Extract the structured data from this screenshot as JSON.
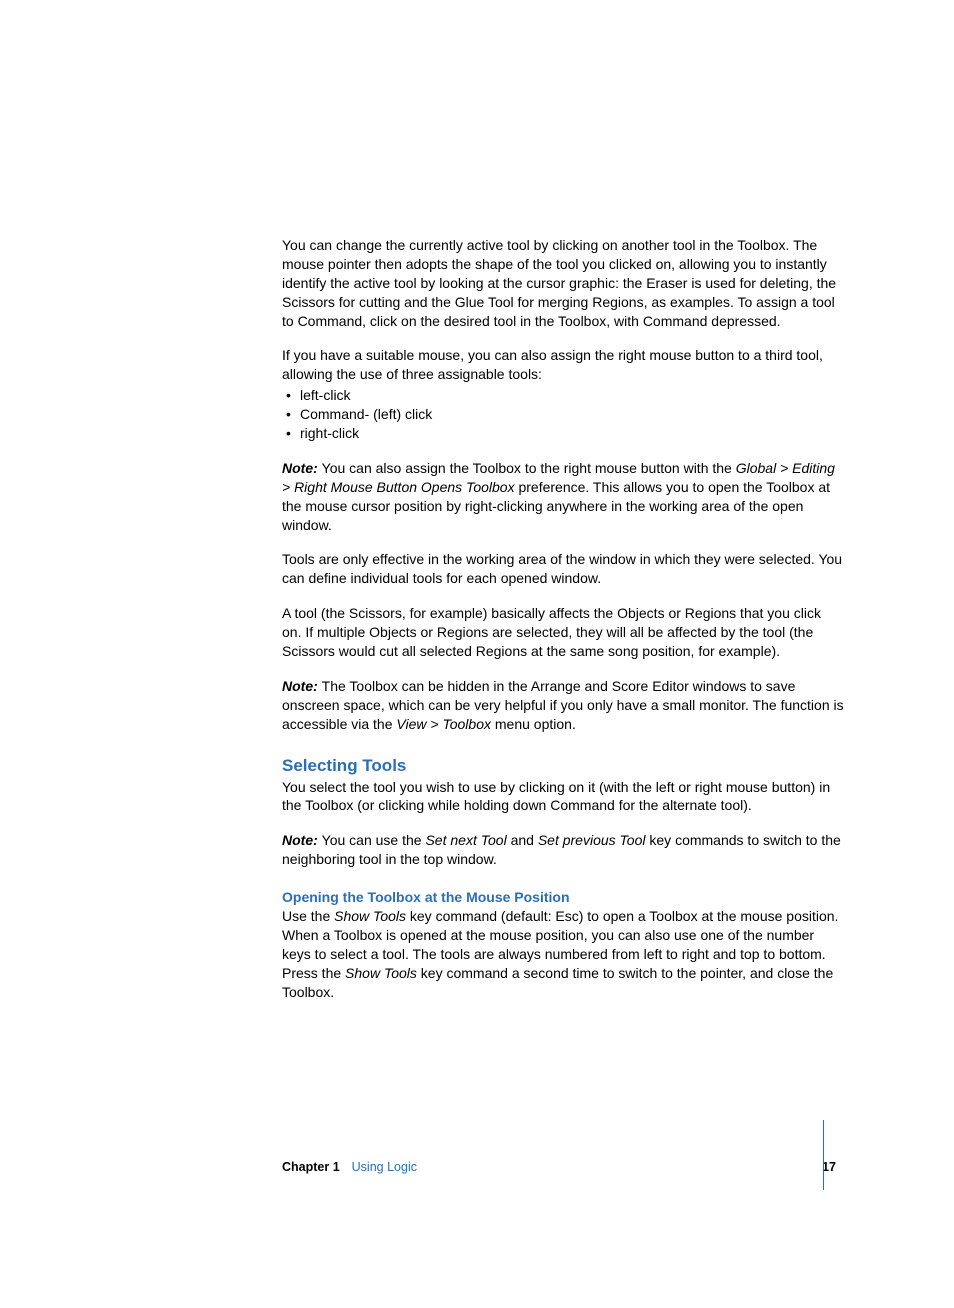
{
  "paragraphs": {
    "p1": "You can change the currently active tool by clicking on another tool in the Toolbox. The mouse pointer then adopts the shape of the tool you clicked on, allowing you to instantly identify the active tool by looking at the cursor graphic:  the Eraser is used for deleting, the Scissors for cutting and the Glue Tool for merging Regions, as examples. To assign a tool to Command, click on the desired tool in the Toolbox, with Command depressed.",
    "p2": "If you have a suitable mouse, you can also assign the right mouse button to a third tool, allowing the use of three assignable tools:",
    "bullets": [
      "left-click",
      "Command- (left) click",
      "right-click"
    ],
    "note1_label": "Note:  ",
    "note1_a": "You can also assign the Toolbox to the right mouse button with the ",
    "note1_path": "Global > Editing > Right Mouse Button Opens Toolbox",
    "note1_b": " preference. This allows you to open the Toolbox at the mouse cursor position by right-clicking anywhere in the working area of the open window.",
    "p4": "Tools are only effective in the working area of the window in which they were selected. You can define individual tools for each opened window.",
    "p5": "A tool (the Scissors, for example) basically affects the Objects or Regions that you click on. If multiple Objects or Regions are selected, they will all be affected by the tool (the Scissors would cut all selected Regions at the same song position, for example).",
    "note2_label": "Note:  ",
    "note2_a": "The Toolbox can be hidden in the Arrange and Score Editor windows to save onscreen space, which can be very helpful if you only have a small monitor. The function is accessible via the ",
    "note2_path": "View > Toolbox",
    "note2_b": " menu option.",
    "heading1": "Selecting Tools",
    "p7": "You select the tool you wish to use by clicking on it (with the left or right mouse button) in the Toolbox (or clicking while holding down Command for the alternate tool).",
    "note3_label": "Note:  ",
    "note3_a": "You can use the ",
    "note3_i1": "Set next Tool",
    "note3_b": " and ",
    "note3_i2": "Set previous Tool",
    "note3_c": " key commands to switch to the neighboring tool in the top window.",
    "heading2": "Opening the Toolbox at the Mouse Position",
    "p9a": "Use the ",
    "p9_i1": "Show Tools",
    "p9b": " key command (default:  Esc) to open a Toolbox at the mouse position. When a Toolbox is opened at the mouse position, you can also use one of the number keys to select a tool. The tools are always numbered from left to right and top to bottom. Press the ",
    "p9_i2": "Show Tools",
    "p9c": " key command a second time to switch to the pointer, and close the Toolbox."
  },
  "footer": {
    "chapter_label": "Chapter 1",
    "chapter_title": "Using Logic",
    "page_number": "17"
  }
}
